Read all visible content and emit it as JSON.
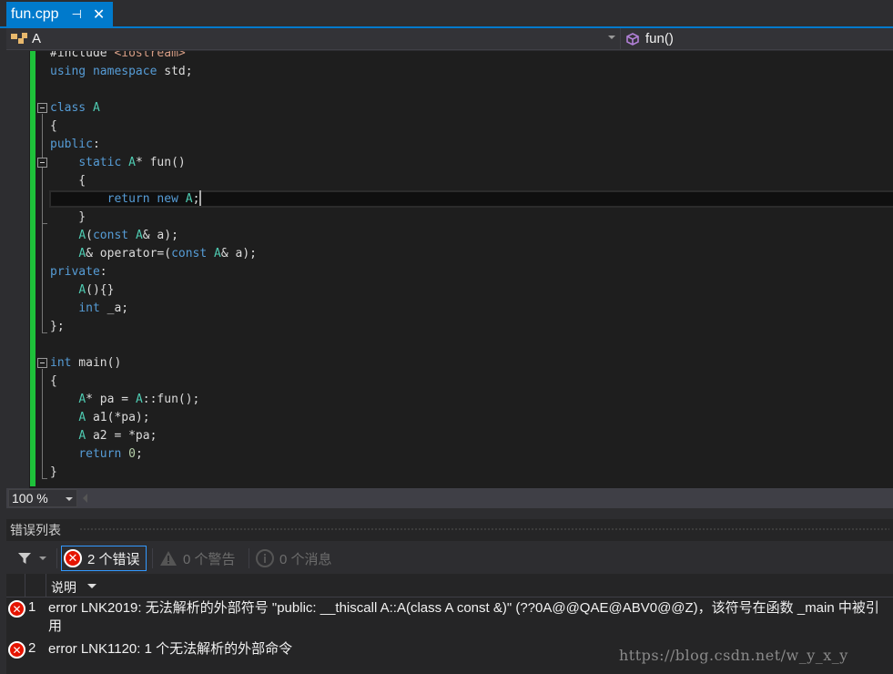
{
  "tab": {
    "title": "fun.cpp",
    "pin_icon": "pin-icon",
    "close_icon": "close-icon"
  },
  "nav": {
    "scope": "A",
    "member": "fun()"
  },
  "code": [
    [
      [
        "tx",
        "#include "
      ],
      [
        "str",
        "<iostream>"
      ]
    ],
    [
      [
        "kw",
        "using"
      ],
      [
        "tx",
        " "
      ],
      [
        "kw",
        "namespace"
      ],
      [
        "tx",
        " std;"
      ]
    ],
    [],
    [
      [
        "kw",
        "class"
      ],
      [
        "tx",
        " "
      ],
      [
        "ty",
        "A"
      ]
    ],
    [
      [
        "tx",
        "{"
      ]
    ],
    [
      [
        "kw",
        "public"
      ],
      [
        "tx",
        ":"
      ]
    ],
    [
      [
        "tx",
        "    "
      ],
      [
        "kw",
        "static"
      ],
      [
        "tx",
        " "
      ],
      [
        "ty",
        "A"
      ],
      [
        "tx",
        "* fun()"
      ]
    ],
    [
      [
        "tx",
        "    {"
      ]
    ],
    [
      [
        "tx",
        "        "
      ],
      [
        "kw",
        "return"
      ],
      [
        "tx",
        " "
      ],
      [
        "kw",
        "new"
      ],
      [
        "tx",
        " "
      ],
      [
        "ty",
        "A"
      ],
      [
        "tx",
        ";"
      ]
    ],
    [
      [
        "tx",
        "    }"
      ]
    ],
    [
      [
        "tx",
        "    "
      ],
      [
        "ty",
        "A"
      ],
      [
        "tx",
        "("
      ],
      [
        "kw",
        "const"
      ],
      [
        "tx",
        " "
      ],
      [
        "ty",
        "A"
      ],
      [
        "tx",
        "& a);"
      ]
    ],
    [
      [
        "tx",
        "    "
      ],
      [
        "ty",
        "A"
      ],
      [
        "tx",
        "& operator=("
      ],
      [
        "kw",
        "const"
      ],
      [
        "tx",
        " "
      ],
      [
        "ty",
        "A"
      ],
      [
        "tx",
        "& a);"
      ]
    ],
    [
      [
        "kw",
        "private"
      ],
      [
        "tx",
        ":"
      ]
    ],
    [
      [
        "tx",
        "    "
      ],
      [
        "ty",
        "A"
      ],
      [
        "tx",
        "(){}"
      ]
    ],
    [
      [
        "tx",
        "    "
      ],
      [
        "kw",
        "int"
      ],
      [
        "tx",
        " _a;"
      ]
    ],
    [
      [
        "tx",
        "};"
      ]
    ],
    [],
    [
      [
        "kw",
        "int"
      ],
      [
        "tx",
        " main()"
      ]
    ],
    [
      [
        "tx",
        "{"
      ]
    ],
    [
      [
        "tx",
        "    "
      ],
      [
        "ty",
        "A"
      ],
      [
        "tx",
        "* pa = "
      ],
      [
        "ty",
        "A"
      ],
      [
        "tx",
        "::fun();"
      ]
    ],
    [
      [
        "tx",
        "    "
      ],
      [
        "ty",
        "A"
      ],
      [
        "tx",
        " a1(*pa);"
      ]
    ],
    [
      [
        "tx",
        "    "
      ],
      [
        "ty",
        "A"
      ],
      [
        "tx",
        " a2 = *pa;"
      ]
    ],
    [
      [
        "tx",
        "    "
      ],
      [
        "kw",
        "return"
      ],
      [
        "tx",
        " "
      ],
      [
        "num",
        "0"
      ],
      [
        "tx",
        ";"
      ]
    ],
    [
      [
        "tx",
        "}"
      ]
    ]
  ],
  "zoom_level": "100 %",
  "error_list": {
    "title": "错误列表",
    "errors_label": "2 个错误",
    "warnings_label": "0 个警告",
    "messages_label": "0 个消息",
    "column_description": "说明",
    "rows": [
      {
        "num": "1",
        "description": "error LNK2019: 无法解析的外部符号 \"public: __thiscall A::A(class A const &)\" (??0A@@QAE@ABV0@@Z)，该符号在函数 _main 中被引用"
      },
      {
        "num": "2",
        "description": "error LNK1120: 1 个无法解析的外部命令"
      }
    ]
  },
  "watermark": "https://blog.csdn.net/w_y_x_y",
  "colors": {
    "accent": "#007acc",
    "keyword": "#569cd6",
    "type": "#4ec9b0",
    "string": "#d69d85",
    "error": "#e51400",
    "changed_bar": "#1ec23a"
  }
}
